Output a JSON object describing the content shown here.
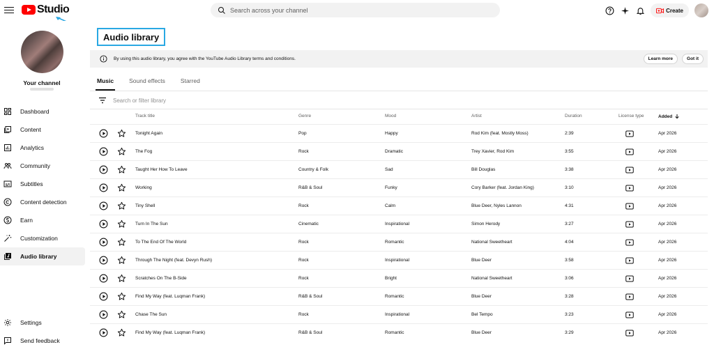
{
  "header": {
    "logo_text": "Studio",
    "search_placeholder": "Search across your channel",
    "create_label": "Create"
  },
  "sidebar": {
    "channel_label": "Your channel",
    "items": [
      {
        "label": "Dashboard",
        "icon": "dashboard-icon"
      },
      {
        "label": "Content",
        "icon": "content-icon"
      },
      {
        "label": "Analytics",
        "icon": "analytics-icon"
      },
      {
        "label": "Community",
        "icon": "community-icon"
      },
      {
        "label": "Subtitles",
        "icon": "subtitles-icon"
      },
      {
        "label": "Content detection",
        "icon": "copyright-icon"
      },
      {
        "label": "Earn",
        "icon": "dollar-icon"
      },
      {
        "label": "Customization",
        "icon": "magic-wand-icon"
      },
      {
        "label": "Audio library",
        "icon": "audio-library-icon",
        "active": true
      }
    ],
    "bottom_items": [
      {
        "label": "Settings",
        "icon": "gear-icon"
      },
      {
        "label": "Send feedback",
        "icon": "feedback-icon"
      }
    ]
  },
  "main": {
    "title": "Audio library",
    "notice": {
      "text": "By using this audio library, you agree with the YouTube Audio Library terms and conditions.",
      "learn_more": "Learn more",
      "got_it": "Got it"
    },
    "tabs": [
      {
        "label": "Music",
        "active": true
      },
      {
        "label": "Sound effects",
        "active": false
      },
      {
        "label": "Starred",
        "active": false
      }
    ],
    "filter_placeholder": "Search or filter library",
    "columns": {
      "track": "Track title",
      "genre": "Genre",
      "mood": "Mood",
      "artist": "Artist",
      "duration": "Duration",
      "license": "License type",
      "added": "Added"
    },
    "rows": [
      {
        "title": "Tonight Again",
        "genre": "Pop",
        "mood": "Happy",
        "artist": "Rod Kim (feat. Mostly Moss)",
        "duration": "2:39",
        "added": "Apr 2026"
      },
      {
        "title": "The Fog",
        "genre": "Rock",
        "mood": "Dramatic",
        "artist": "Trey Xavier, Rod Kim",
        "duration": "3:55",
        "added": "Apr 2026"
      },
      {
        "title": "Taught Her How To Leave",
        "genre": "Country & Folk",
        "mood": "Sad",
        "artist": "Bill Douglas",
        "duration": "3:38",
        "added": "Apr 2026"
      },
      {
        "title": "Working",
        "genre": "R&B & Soul",
        "mood": "Funky",
        "artist": "Cory Barker (feat. Jordan King)",
        "duration": "3:10",
        "added": "Apr 2026"
      },
      {
        "title": "Tiny Shell",
        "genre": "Rock",
        "mood": "Calm",
        "artist": "Blue Deer, Nyles Lannon",
        "duration": "4:31",
        "added": "Apr 2026"
      },
      {
        "title": "Turn In The Sun",
        "genre": "Cinematic",
        "mood": "Inspirational",
        "artist": "Simon Herody",
        "duration": "3:27",
        "added": "Apr 2026"
      },
      {
        "title": "To The End Of The World",
        "genre": "Rock",
        "mood": "Romantic",
        "artist": "National Sweetheart",
        "duration": "4:04",
        "added": "Apr 2026"
      },
      {
        "title": "Through The Night (feat. Devyn Rush)",
        "genre": "Rock",
        "mood": "Inspirational",
        "artist": "Blue Deer",
        "duration": "3:58",
        "added": "Apr 2026"
      },
      {
        "title": "Scratches On The B-Side",
        "genre": "Rock",
        "mood": "Bright",
        "artist": "National Sweetheart",
        "duration": "3:06",
        "added": "Apr 2026"
      },
      {
        "title": "Find My Way (feat. Luqman Frank)",
        "genre": "R&B & Soul",
        "mood": "Romantic",
        "artist": "Blue Deer",
        "duration": "3:28",
        "added": "Apr 2026"
      },
      {
        "title": "Chase The Sun",
        "genre": "Rock",
        "mood": "Inspirational",
        "artist": "Bel Tempo",
        "duration": "3:23",
        "added": "Apr 2026"
      },
      {
        "title": "Find My Way (feat. Luqman Frank)",
        "genre": "R&B & Soul",
        "mood": "Romantic",
        "artist": "Blue Deer",
        "duration": "3:29",
        "added": "Apr 2026"
      }
    ]
  },
  "colors": {
    "brand_red": "#ff0000",
    "highlight_blue": "#29a8e3",
    "text": "#0f0f0f",
    "muted": "#606060"
  }
}
